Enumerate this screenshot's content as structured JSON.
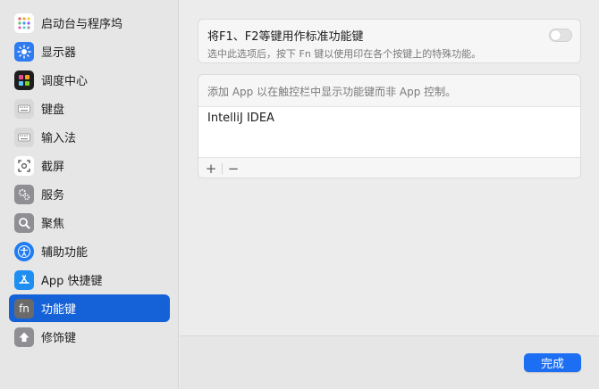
{
  "sidebar": {
    "items": [
      {
        "label": "启动台与程序坞",
        "icon": "launchpad-icon",
        "active": false
      },
      {
        "label": "显示器",
        "icon": "display-icon",
        "active": false
      },
      {
        "label": "调度中心",
        "icon": "mission-control-icon",
        "active": false
      },
      {
        "label": "键盘",
        "icon": "keyboard-icon",
        "active": false
      },
      {
        "label": "输入法",
        "icon": "input-method-icon",
        "active": false
      },
      {
        "label": "截屏",
        "icon": "screenshot-icon",
        "active": false
      },
      {
        "label": "服务",
        "icon": "services-icon",
        "active": false
      },
      {
        "label": "聚焦",
        "icon": "spotlight-icon",
        "active": false
      },
      {
        "label": "辅助功能",
        "icon": "accessibility-icon",
        "active": false
      },
      {
        "label": "App 快捷键",
        "icon": "app-store-icon",
        "active": false
      },
      {
        "label": "功能键",
        "icon": "fn-icon",
        "active": true
      },
      {
        "label": "修饰键",
        "icon": "modifier-icon",
        "active": false
      }
    ],
    "fn_glyph": "fn"
  },
  "main": {
    "fkeys": {
      "title": "将F1、F2等键用作标准功能键",
      "subtitle": "选中此选项后，按下 Fn 键以使用印在各个按键上的特殊功能。",
      "toggle_on": false
    },
    "apps": {
      "header": "添加 App 以在触控栏中显示功能键而非 App 控制。",
      "list": [
        "IntelliJ IDEA"
      ],
      "add_symbol": "+",
      "remove_symbol": "−"
    }
  },
  "footer": {
    "done_label": "完成"
  },
  "colors": {
    "accent": "#1561d7",
    "done_button": "#1c6ef2"
  }
}
